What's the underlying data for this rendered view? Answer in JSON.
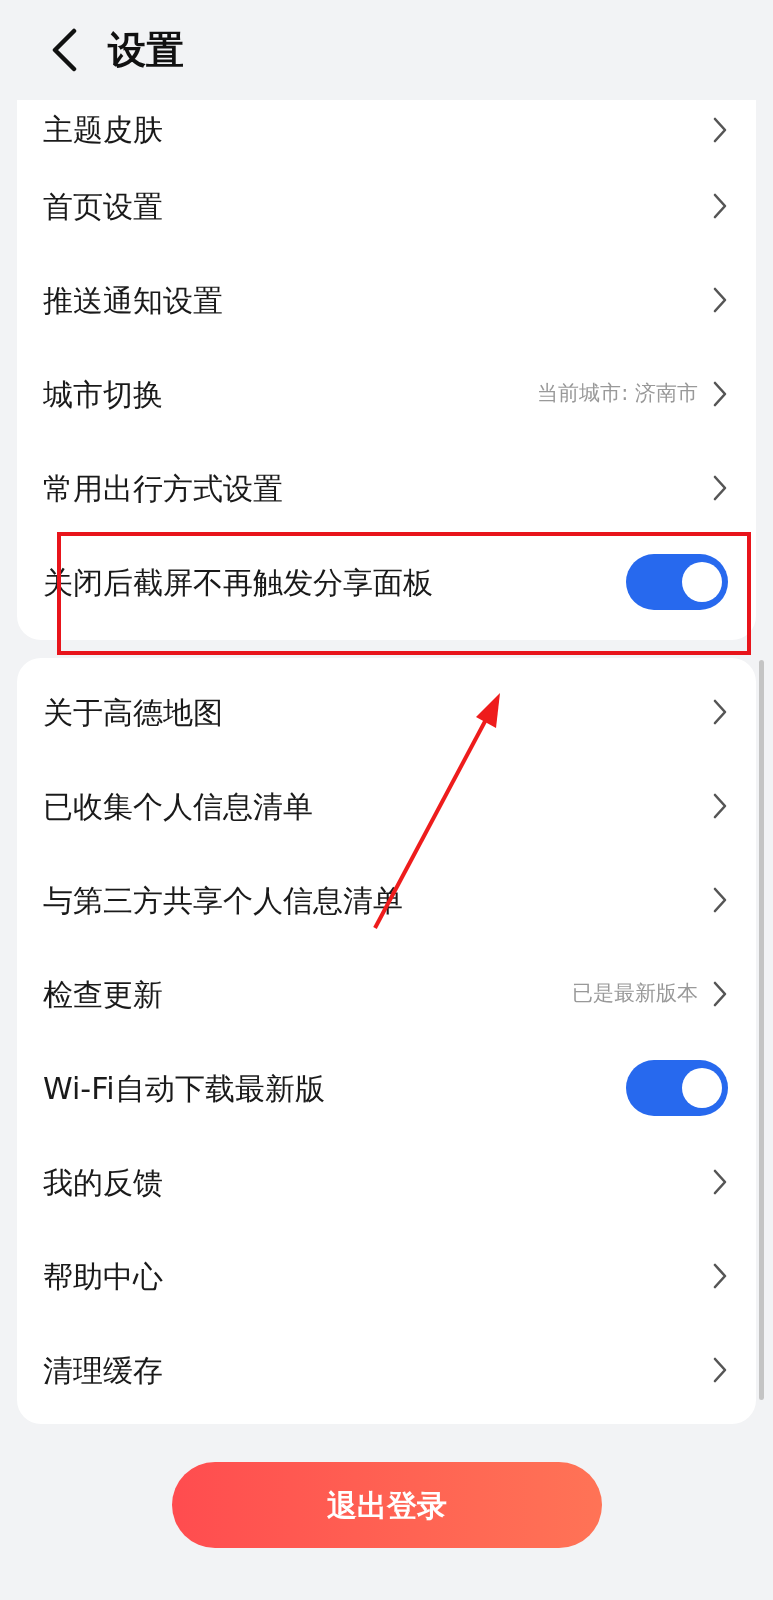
{
  "header": {
    "title": "设置"
  },
  "sections": [
    {
      "rows": [
        {
          "kind": "link",
          "label": "主题皮肤"
        },
        {
          "kind": "link",
          "label": "首页设置"
        },
        {
          "kind": "link",
          "label": "推送通知设置"
        },
        {
          "kind": "link",
          "label": "城市切换",
          "value": "当前城市: 济南市"
        },
        {
          "kind": "link",
          "label": "常用出行方式设置"
        },
        {
          "kind": "toggle",
          "label": "关闭后截屏不再触发分享面板",
          "on": true
        }
      ]
    },
    {
      "rows": [
        {
          "kind": "link",
          "label": "关于高德地图"
        },
        {
          "kind": "link",
          "label": "已收集个人信息清单"
        },
        {
          "kind": "link",
          "label": "与第三方共享个人信息清单"
        },
        {
          "kind": "link",
          "label": "检查更新",
          "value": "已是最新版本"
        },
        {
          "kind": "toggle",
          "label": "Wi-Fi自动下载最新版",
          "on": true
        },
        {
          "kind": "link",
          "label": "我的反馈"
        },
        {
          "kind": "link",
          "label": "帮助中心"
        },
        {
          "kind": "link",
          "label": "清理缓存"
        }
      ]
    }
  ],
  "logout_button": {
    "label": "退出登录"
  }
}
